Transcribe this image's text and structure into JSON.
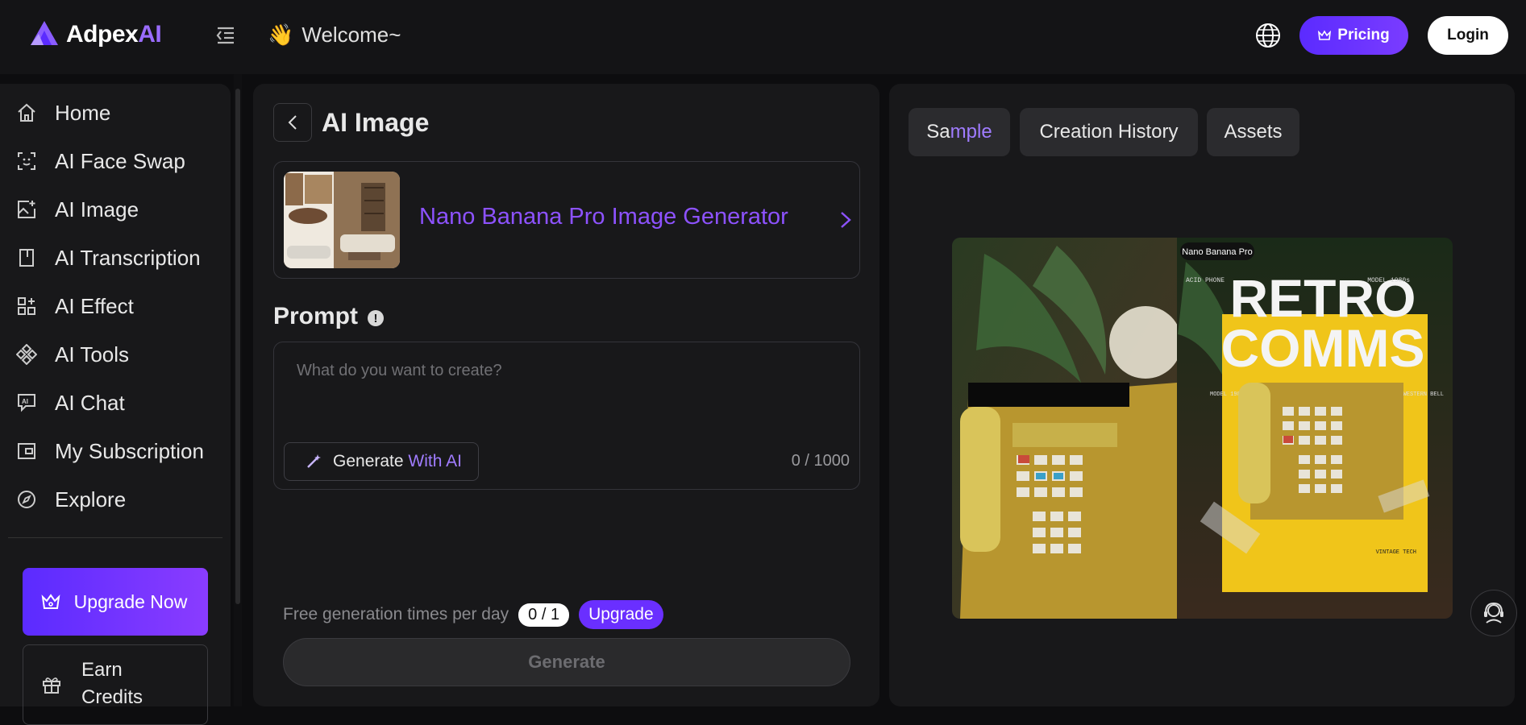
{
  "header": {
    "logo_text_main": "Adpex",
    "logo_text_ai": "AI",
    "welcome_emoji": "👋",
    "welcome_text": "Welcome~",
    "pricing_label": "Pricing",
    "login_label": "Login"
  },
  "sidebar": {
    "items": [
      {
        "label": "Home",
        "icon": "home-icon"
      },
      {
        "label": "AI Face Swap",
        "icon": "face-scan-icon"
      },
      {
        "label": "AI Image",
        "icon": "image-plus-icon"
      },
      {
        "label": "AI Transcription",
        "icon": "document-icon"
      },
      {
        "label": "AI Effect",
        "icon": "effect-grid-icon"
      },
      {
        "label": "AI Tools",
        "icon": "tools-diamond-icon"
      },
      {
        "label": "AI Chat",
        "icon": "chat-ai-icon"
      },
      {
        "label": "My Subscription",
        "icon": "wallet-icon"
      },
      {
        "label": "Explore",
        "icon": "compass-icon"
      }
    ],
    "upgrade_label": "Upgrade Now",
    "earn_label": "Earn Credits"
  },
  "editor": {
    "title": "AI Image",
    "model_name": "Nano Banana Pro Image Generator",
    "prompt_label": "Prompt",
    "prompt_placeholder": "What do you want to create?",
    "generate_ai_prefix": "Generate",
    "generate_ai_suffix": "With AI",
    "char_count": "0 / 1000",
    "free_label": "Free generation times per day",
    "free_count": "0 / 1",
    "upgrade_pill": "Upgrade",
    "generate_label": "Generate"
  },
  "preview": {
    "tabs": [
      {
        "label_a": "Sa",
        "label_b": "mple"
      },
      {
        "label": "Creation History"
      },
      {
        "label": "Assets"
      }
    ],
    "badge": "Nano Banana Pro",
    "poster_top_left": "ACID PHONE",
    "poster_top_right": "MODEL 1980s",
    "poster_title_1": "RETRO",
    "poster_title_2": "COMMS",
    "poster_mid_left": "MODEL 1980s",
    "poster_mid_right": "SOUTHWESTERN BELL",
    "poster_bottom_right": "VINTAGE TECH"
  },
  "colors": {
    "accent": "#7a3cff",
    "accent_text": "#8d52ff",
    "background": "#0d0d0f",
    "panel": "#18181a"
  }
}
